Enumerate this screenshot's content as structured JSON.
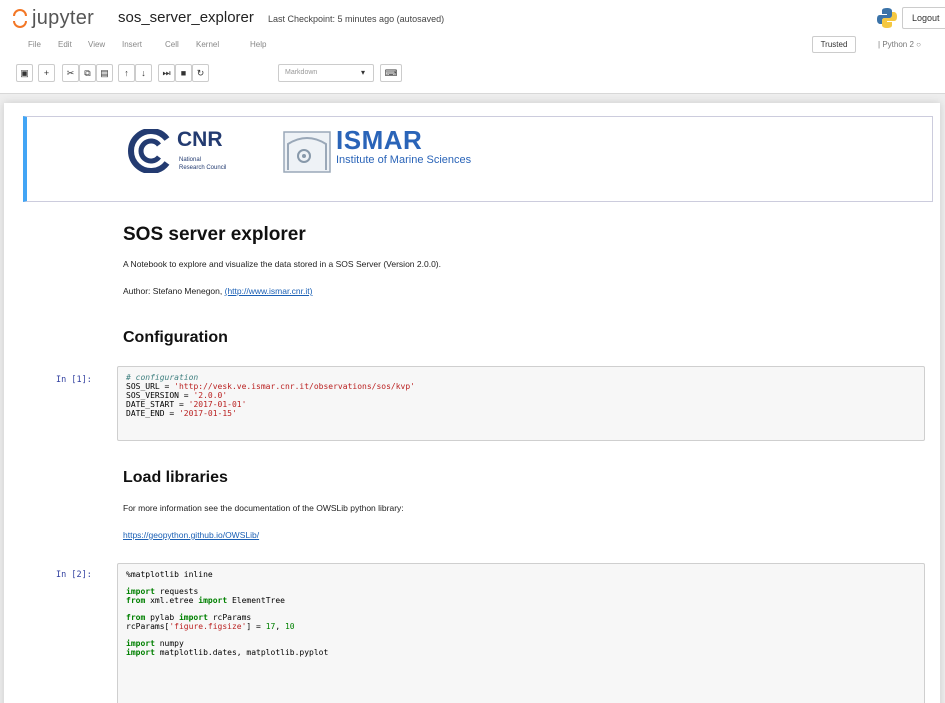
{
  "header": {
    "app_name": "jupyter",
    "notebook_name": "sos_server_explorer",
    "checkpoint": "Last Checkpoint: 5 minutes ago (autosaved)",
    "logout_label": "Logout"
  },
  "menu": [
    "File",
    "Edit",
    "View",
    "Insert",
    "Cell",
    "Kernel",
    "Help"
  ],
  "status": {
    "trusted": "Trusted",
    "kernel": "Python 2"
  },
  "toolbar": {
    "buttons": [
      "save-icon",
      "add-icon",
      "cut-icon",
      "copy-icon",
      "paste-icon",
      "move-up-icon",
      "move-down-icon",
      "run-icon",
      "stop-icon",
      "restart-icon"
    ],
    "cell_type": "Markdown",
    "keyboard_icon": "keyboard-icon"
  },
  "logos": {
    "cnr_title": "CNR",
    "cnr_sub1": "National",
    "cnr_sub2": "Research Council",
    "ismar_title": "ISMAR",
    "ismar_sub": "Institute of Marine Sciences"
  },
  "notebook": {
    "title": "SOS server explorer",
    "intro": "A Notebook to explore and visualize the data stored in a SOS Server (Version 2.0.0).",
    "author_prefix": "Author: Stefano Menegon, ",
    "author_link": "(http://www.ismar.cnr.it)",
    "config_heading": "Configuration",
    "cell1_prompt": "In [1]:",
    "cell1": {
      "comment": "# configuration",
      "l1_a": "SOS_URL = ",
      "l1_b": "'http://vesk.ve.ismar.cnr.it/observations/sos/kvp'",
      "l2_a": "SOS_VERSION = ",
      "l2_b": "'2.0.0'",
      "l3_a": "DATE_START = ",
      "l3_b": "'2017-01-01'",
      "l4_a": "DATE_END = ",
      "l4_b": "'2017-01-15'"
    },
    "load_heading": "Load libraries",
    "load_text": "For more information see the documentation of the OWSLib python library:",
    "owslib_link": "https://geopython.github.io/OWSLib/",
    "cell2_prompt": "In [2]:",
    "cell2": {
      "magic": "%matplotlib inline",
      "import": "import",
      "from": "from",
      "requests": " requests",
      "etree_mod": " xml.etree ",
      "etree_name": " ElementTree",
      "pylab_mod": " pylab ",
      "pylab_name": " rcParams",
      "rc_a": "rcParams[",
      "rc_b": "'figure.figsize'",
      "rc_c": "] = ",
      "rc_d": "17",
      "rc_e": ", ",
      "rc_f": "10",
      "numpy": " numpy",
      "mpl": " matplotlib.dates, matplotlib.pyplot"
    }
  }
}
